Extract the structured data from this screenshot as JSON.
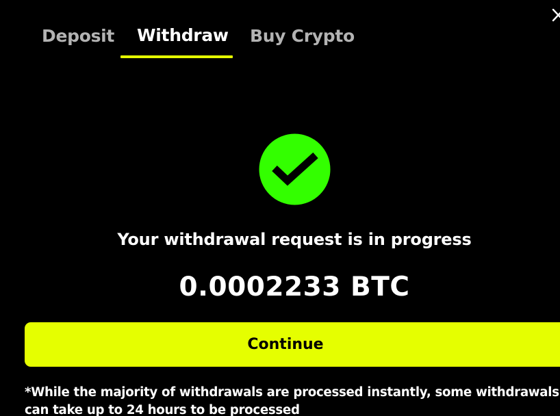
{
  "tabs": [
    {
      "label": "Deposit",
      "active": false
    },
    {
      "label": "Withdraw",
      "active": true
    },
    {
      "label": "Buy Crypto",
      "active": false
    }
  ],
  "icons": {
    "close": "close-icon",
    "success": "check-circle-icon"
  },
  "status": {
    "message": "Your withdrawal request is in progress",
    "amount": "0.0002233 BTC"
  },
  "actions": {
    "continue_label": "Continue"
  },
  "disclaimer": "*While the majority of withdrawals are processed instantly, some withdrawals can take up to 24 hours to be processed",
  "colors": {
    "background": "#000000",
    "accent": "#e5ff00",
    "success": "#33ff00",
    "inactive_tab": "#b3b3b3",
    "text": "#ffffff"
  }
}
